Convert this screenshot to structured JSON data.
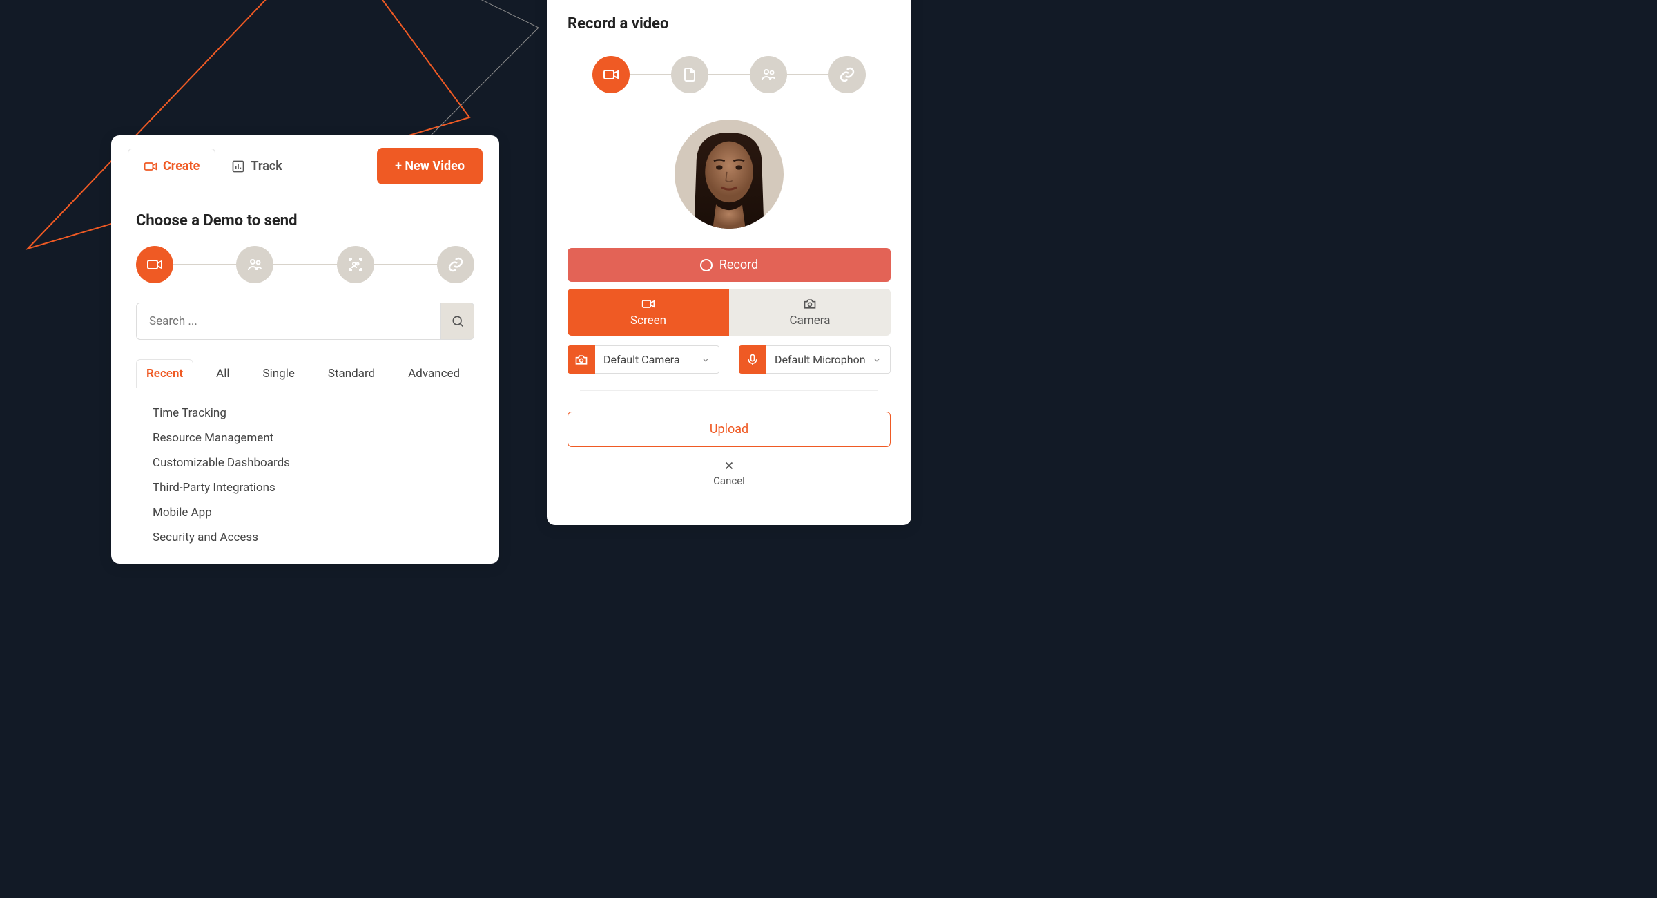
{
  "colors": {
    "accent": "#ef5a24",
    "bg": "#121a26"
  },
  "leftCard": {
    "tabs": [
      {
        "label": "Create",
        "active": true
      },
      {
        "label": "Track",
        "active": false
      }
    ],
    "newVideoLabel": "+ New Video",
    "sectionTitle": "Choose a Demo to send",
    "searchPlaceholder": "Search ...",
    "filterTabs": [
      {
        "label": "Recent",
        "active": true
      },
      {
        "label": "All"
      },
      {
        "label": "Single"
      },
      {
        "label": "Standard"
      },
      {
        "label": "Advanced"
      }
    ],
    "demos": [
      "Time Tracking",
      "Resource Management",
      "Customizable Dashboards",
      "Third-Party Integrations",
      "Mobile App",
      "Security and Access"
    ]
  },
  "rightCard": {
    "title": "Record a video",
    "recordLabel": "Record",
    "screenLabel": "Screen",
    "cameraLabel": "Camera",
    "cameraSelect": "Default Camera",
    "micSelect": "Default Microphon",
    "uploadLabel": "Upload",
    "cancelLabel": "Cancel"
  }
}
